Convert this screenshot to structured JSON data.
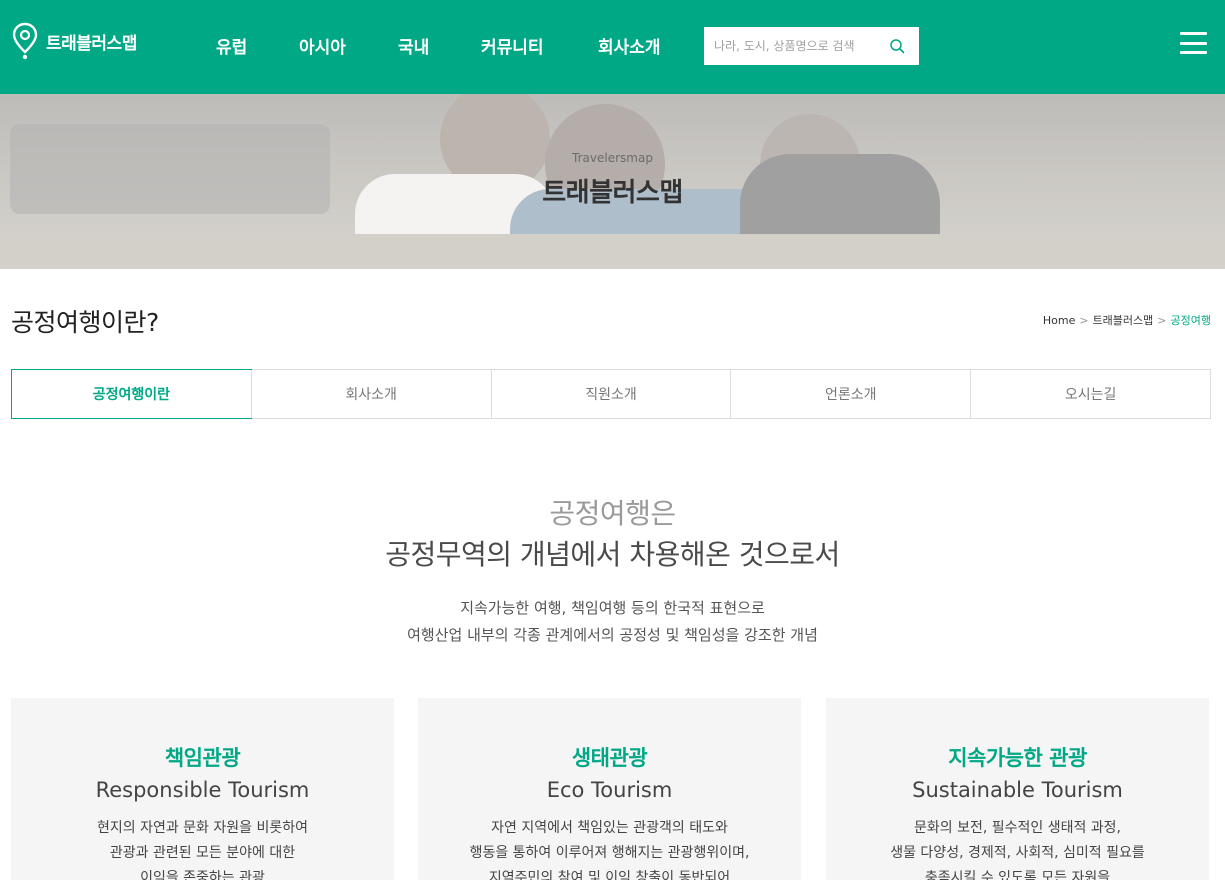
{
  "header": {
    "logo_text": "트래블러스맵",
    "nav": [
      "유럽",
      "아시아",
      "국내",
      "커뮤니티",
      "회사소개"
    ],
    "search_placeholder": "나라, 도시, 상품명으로 검색",
    "brand_color": "#00a886"
  },
  "hero": {
    "subtitle": "Travelersmap",
    "title": "트래블러스맵"
  },
  "page": {
    "title": "공정여행이란?",
    "breadcrumb": [
      "Home",
      "트래블러스맵",
      "공정여행"
    ]
  },
  "tabs": [
    {
      "label": "공정여행이란",
      "active": true
    },
    {
      "label": "회사소개",
      "active": false
    },
    {
      "label": "직원소개",
      "active": false
    },
    {
      "label": "언론소개",
      "active": false
    },
    {
      "label": "오시는길",
      "active": false
    }
  ],
  "intro": {
    "line1": "공정여행은",
    "line2": "공정무역의 개념에서 차용해온 것으로서",
    "desc1": "지속가능한 여행, 책임여행 등의 한국적 표현으로",
    "desc2": "여행산업 내부의 각종 관계에서의 공정성 및 책임성을 강조한 개념"
  },
  "cards": [
    {
      "title_ko": "책임관광",
      "title_en": "Responsible Tourism",
      "lines": [
        "현지의 자연과 문화 자원을 비롯하여",
        "관광과 관련된 모든 분야에 대한",
        "이익을 존중하는 관광"
      ]
    },
    {
      "title_ko": "생태관광",
      "title_en": "Eco Tourism",
      "lines": [
        "자연 지역에서 책임있는 관광객의 태도와",
        "행동을 통하여 이루어져 행해지는 관광행위이며,",
        "지역주민의 참여 및 이익 창출이 동반되어"
      ]
    },
    {
      "title_ko": "지속가능한 관광",
      "title_en": "Sustainable Tourism",
      "lines": [
        "문화의 보전, 필수적인 생태적 과정,",
        "생물 다양성, 경제적, 사회적, 심미적 필요를",
        "충족시킬 수 있도록 모든 자원을"
      ]
    }
  ]
}
